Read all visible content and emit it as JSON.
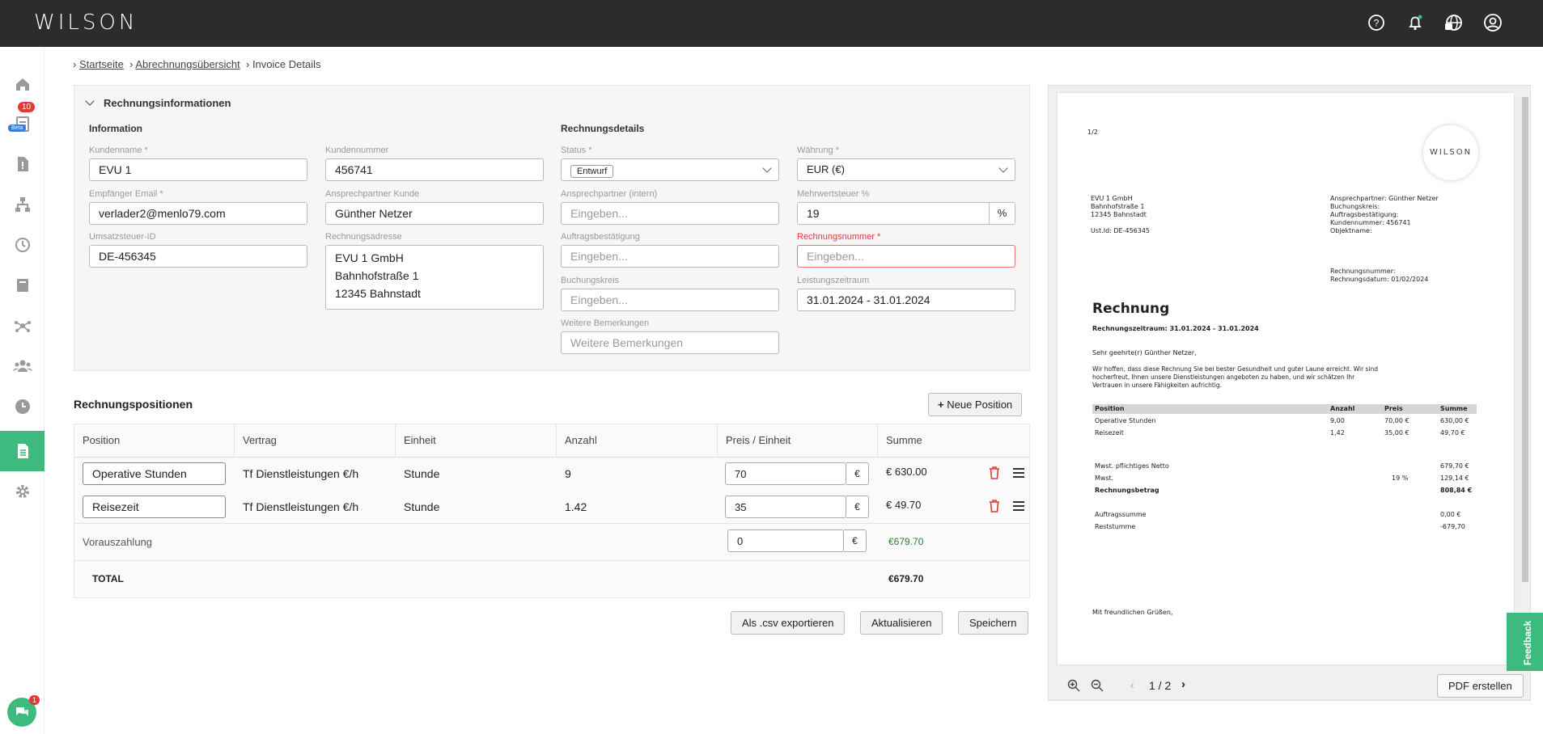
{
  "brand": {
    "logo": "WILSON"
  },
  "sidebar": {
    "badge_count": "10",
    "beta_label": "Beta"
  },
  "breadcrumb": {
    "home": "Startseite",
    "overview": "Abrechnungsübersicht",
    "current": "Invoice Details"
  },
  "invoice_info": {
    "section_title": "Rechnungsinformationen",
    "info_heading": "Information",
    "details_heading": "Rechnungsdetails",
    "customer_name": {
      "label": "Kundenname *",
      "value": "EVU 1"
    },
    "customer_number": {
      "label": "Kundennummer",
      "value": "456741"
    },
    "recipient_email": {
      "label": "Empfänger Email *",
      "value": "verlader2@menlo79.com"
    },
    "contact_customer": {
      "label": "Ansprechpartner Kunde",
      "value": "Günther Netzer"
    },
    "vat_id": {
      "label": "Umsatzsteuer-ID",
      "value": "DE-456345"
    },
    "invoice_address": {
      "label": "Rechnungsadresse",
      "line1": "EVU 1 GmbH",
      "line2": "Bahnhofstraße 1",
      "line3": "12345 Bahnstadt"
    },
    "status": {
      "label": "Status *",
      "value": "Entwurf"
    },
    "currency": {
      "label": "Währung *",
      "value": "EUR (€)"
    },
    "contact_internal": {
      "label": "Ansprechpartner (intern)",
      "placeholder": "Eingeben..."
    },
    "vat_percent": {
      "label": "Mehrwertsteuer %",
      "value": "19",
      "unit": "%"
    },
    "order_confirmation": {
      "label": "Auftragsbestätigung",
      "placeholder": "Eingeben..."
    },
    "invoice_number": {
      "label": "Rechnungsnummer *",
      "placeholder": "Eingeben..."
    },
    "booking_circle": {
      "label": "Buchungskreis",
      "placeholder": "Eingeben..."
    },
    "service_period": {
      "label": "Leistungszeitraum",
      "value": "31.01.2024 - 31.01.2024"
    },
    "remarks": {
      "label": "Weitere Bemerkungen",
      "placeholder": "Weitere Bemerkungen"
    }
  },
  "positions": {
    "title": "Rechnungspositionen",
    "new_button": "Neue Position",
    "headers": [
      "Position",
      "Vertrag",
      "Einheit",
      "Anzahl",
      "Preis / Einheit",
      "Summe"
    ],
    "rows": [
      {
        "position": "Operative Stunden",
        "contract": "Tf Dienstleistungen €/h",
        "unit": "Stunde",
        "qty": "9",
        "price": "70",
        "currency": "€",
        "sum": "€ 630.00"
      },
      {
        "position": "Reisezeit",
        "contract": "Tf Dienstleistungen €/h",
        "unit": "Stunde",
        "qty": "1.42",
        "price": "35",
        "currency": "€",
        "sum": "€ 49.70"
      }
    ],
    "prepayment": {
      "label": "Vorauszahlung",
      "value": "0",
      "currency": "€",
      "sum": "€679.70"
    },
    "total": {
      "label": "TOTAL",
      "value": "€679.70"
    }
  },
  "actions": {
    "export_csv": "Als .csv exportieren",
    "update": "Aktualisieren",
    "save": "Speichern"
  },
  "pdf": {
    "page_counter": "1/2",
    "logo": "WILSON",
    "sender": [
      "EVU 1 GmbH",
      "Bahnhofstraße 1",
      "12345 Bahnstadt"
    ],
    "ust": "Ust.Id: DE-456345",
    "right_block": [
      "Ansprechpartner: Günther Netzer",
      "Buchungskreis:",
      "Auftragsbestätigung:",
      "Kundennummer: 456741",
      "Objektname:"
    ],
    "invoice_no": "Rechnungsnummer:",
    "invoice_date": "Rechnungsdatum: 01/02/2024",
    "title": "Rechnung",
    "period": "Rechnungszeitraum: 31.01.2024 - 31.01.2024",
    "greeting": "Sehr geehrte(r) Günther Netzer,",
    "intro1": "Wir hoffen, dass diese Rechnung Sie bei bester Gesundheit und guter Laune erreicht. Wir sind",
    "intro2": "hocherfreut, Ihnen unsere Dienstleistungen angeboten zu haben, und wir schätzen Ihr",
    "intro3": "Vertrauen in unsere Fähigkeiten aufrichtig.",
    "table_headers": [
      "Position",
      "Anzahl",
      "Preis",
      "Summe"
    ],
    "table_rows": [
      [
        "Operative Stunden",
        "9,00",
        "70,00 €",
        "630,00 €"
      ],
      [
        "Reisezeit",
        "1,42",
        "35,00 €",
        "49,70 €"
      ]
    ],
    "net_label": "Mwst. pflichtiges Netto",
    "net_value": "679,70 €",
    "vat_label": "Mwst.",
    "vat_rate": "19 %",
    "vat_value": "129,14 €",
    "gross_label": "Rechnungsbetrag",
    "gross_value": "808,84 €",
    "order_sum_label": "Auftragssumme",
    "order_sum_value": "0,00 €",
    "rest_label": "Reststumme",
    "rest_value": "-679,70",
    "closing": "Mit freundlichen Grüßen,",
    "pager": "1 / 2",
    "create_button": "PDF erstellen"
  },
  "feedback": {
    "label": "Feedback"
  },
  "chat": {
    "badge": "1"
  }
}
